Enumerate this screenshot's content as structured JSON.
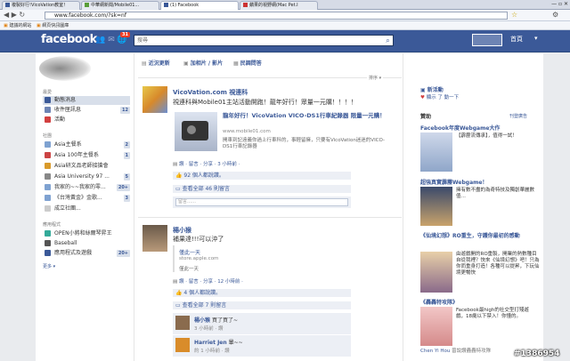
{
  "browser": {
    "tabs": [
      "複製好行!VicoVation教室！",
      "中華網新聞/Mobile01...",
      "(1) Facebook",
      "蘋果的視野網(Mac Pet.I"
    ],
    "url": "www.facebook.com/?sk=nf",
    "bookmarks": [
      "建議的網站",
      "網頁快訊圖庫"
    ]
  },
  "fb": {
    "logo": "facebook",
    "notif_count": "31",
    "search_placeholder": "搜尋",
    "home": "首頁",
    "account": "帳號 ▾"
  },
  "composer": {
    "status": "近況更新",
    "photo": "加相片 / 影片",
    "question": "民調問答"
  },
  "sort_label": "排序 ▾",
  "left_nav": {
    "favorites_head": "最愛",
    "items": [
      {
        "label": "動態消息",
        "count": ""
      },
      {
        "label": "收件匣訊息",
        "count": "12"
      },
      {
        "label": "活動",
        "count": ""
      }
    ],
    "groups_head": "社團",
    "groups": [
      {
        "label": "Asia主餐系",
        "count": "2"
      },
      {
        "label": "Asia 100年主餐系",
        "count": "1"
      },
      {
        "label": "Asia研文品老師接搶會",
        "count": ""
      },
      {
        "label": "Asia University 97 ...",
        "count": "5"
      },
      {
        "label": "我家的~~我家的零...",
        "count": "20+"
      },
      {
        "label": "《台灣黃金》金歌...",
        "count": "3"
      },
      {
        "label": "成立社團...",
        "count": ""
      }
    ],
    "apps_head": "應用程式",
    "apps": [
      {
        "label": "OPEN小將和絲爾琴昇王",
        "count": ""
      },
      {
        "label": "Baseball",
        "count": ""
      },
      {
        "label": "應用程式及遊戲",
        "count": "20+"
      }
    ],
    "more": "更多 ▾"
  },
  "post1": {
    "author": "VicoVation.com 視連科",
    "text": "視連科與Mobile01主站活動開跑！龍年好行！眾量一元購！！！！",
    "link_title": "龍年好行！VicoVation VICO-DS1行車紀錄器 限量一元購！",
    "link_url": "www.mobile01.com",
    "link_desc": "開車到記遠義你過上行車科的，事輕留擁，只要有VicoVation迷迷的VICO-DS1行車記錄器",
    "actions": "讚 · 留言 · 分享 · 3 小時前 ·",
    "likes": "92 個人都說讚。",
    "comments": "查看全部 46 則留言",
    "comment_placeholder": "留言……"
  },
  "post2": {
    "author": "楊小猴",
    "text": "補果達!!!可以沖了",
    "shared_title": "僅此一天",
    "shared_url": "store.apple.com",
    "shared_desc": "僅此一天",
    "actions": "讚 · 留言 · 分享 · 12 小時前 ·",
    "likes": "4 個人都說讚。",
    "comments": "查看全部 7 則留言",
    "c1_name": "楊小猴",
    "c1_text": "買了買了~",
    "c1_meta": "3 小時前 · 讚",
    "c2_name": "Harriet Jen",
    "c2_text": "暈~~",
    "c2_meta": "約 1 小時前 · 讚"
  },
  "right": {
    "ticker_head": "新活動",
    "ticker_sub": "顯示 了 動一下",
    "sponsor_head": "贊助",
    "create_ad": "刊登廣告",
    "ads": [
      {
        "title": "Facebook年度Webgame大作",
        "text": "【霹靂流傳承】，值得一試！"
      },
      {
        "title": "超強真實霹靂Webgame！",
        "text": "擁有數不盡的為奇特技及獨創華麗數值…"
      },
      {
        "title": "《仙境幻想》RO重生，守護你最初的感動",
        "text": "由遊戲開的RO重製，開業的熱數種目自從我裡？快來《仙境幻想》吧！只為你而重身打造！各種可以提昇，下玩仙境更暢快"
      },
      {
        "title": "《轟轟特攻隊》",
        "text": "Facebook最high的社交型打殘遊戲，18歲以下禁入！你懂的。"
      }
    ],
    "footer_name": "Chen Yi Hou",
    "footer_text": "曾說讚轟轟特攻隊"
  },
  "watermark": "#1386954"
}
